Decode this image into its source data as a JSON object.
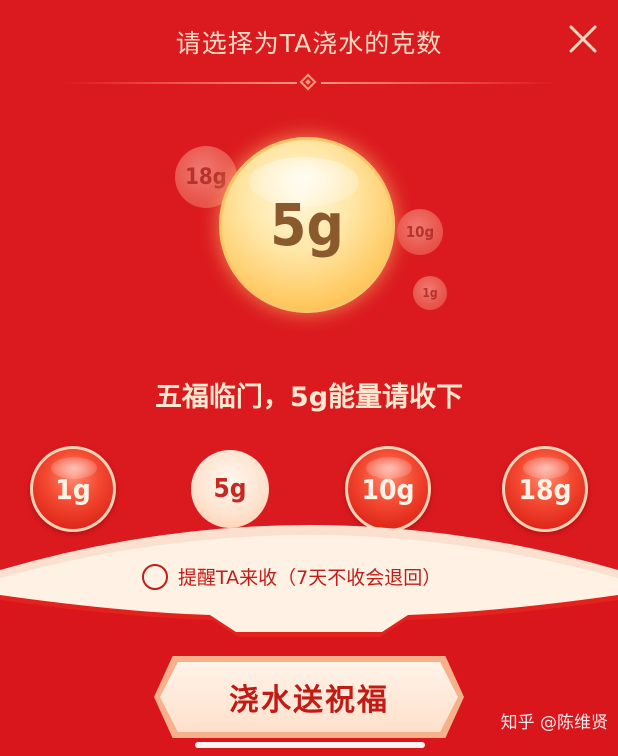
{
  "header": {
    "title": "请选择为TA浇水的克数"
  },
  "bubbles": {
    "main": "5g",
    "b18": "18g",
    "b10": "10g",
    "b1": "1g"
  },
  "subtitle": "五福临门，5g能量请收下",
  "options": [
    {
      "label": "1g"
    },
    {
      "label": "5g",
      "selected": true
    },
    {
      "label": "10g"
    },
    {
      "label": "18g"
    }
  ],
  "reminder": {
    "label": "提醒TA来收（7天不收会退回）",
    "checked": false
  },
  "submit": {
    "label": "浇水送祝福"
  },
  "watermark": "知乎 @陈维贤",
  "colors": {
    "background": "#db1a1f",
    "accent": "#ffd9c2",
    "button_text": "#c21b15"
  }
}
